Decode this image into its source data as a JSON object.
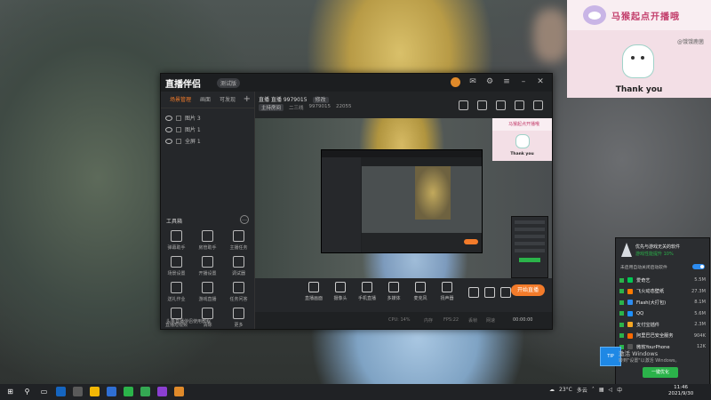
{
  "desktop": {},
  "overlay": {
    "title": "马猴起点开播哦",
    "sub": "@饿饿鹿菌",
    "thank": "Thank you"
  },
  "app": {
    "brand": "直播伴侣",
    "version": "测试版",
    "tabs": [
      "场景管理",
      "画面",
      "可发现"
    ],
    "layers": [
      {
        "name": "图片 3"
      },
      {
        "name": "图片 1"
      },
      {
        "name": "全屏 1"
      }
    ],
    "tools_title": "工具箱",
    "tools": [
      {
        "label": "弹幕助手"
      },
      {
        "label": "房管助手"
      },
      {
        "label": "主播任务"
      },
      {
        "label": "场景设置"
      },
      {
        "label": "开播设置"
      },
      {
        "label": "调试器"
      },
      {
        "label": "送礼作业"
      },
      {
        "label": "游戏直播"
      },
      {
        "label": "任务问答"
      },
      {
        "label": "直播短视频"
      },
      {
        "label": "清除"
      },
      {
        "label": "更多"
      }
    ],
    "left_tip": "头条直播伴侣使用教程",
    "room_title": "直播 直播",
    "room_id": "9979015",
    "room_tag": "修改",
    "room_meta_badge": "主持房间",
    "room_meta_1": "二三线",
    "room_meta_2": "9979015",
    "room_meta_3": "22055",
    "bottom_items": [
      {
        "label": "直播画面"
      },
      {
        "label": "摄像头"
      },
      {
        "label": "手机直播"
      },
      {
        "label": "多媒体"
      },
      {
        "label": "麦克风"
      },
      {
        "label": "扬声器"
      }
    ],
    "start_button": "开始直播",
    "status": {
      "cpu": "CPU: 14%",
      "mem": "内存",
      "fps": "FPS:22",
      "drop": "丢帧",
      "net": "网速",
      "time": "00:00:00"
    },
    "nested_mini": {
      "title": "马猴起点开播哦",
      "thank": "Thank you"
    }
  },
  "popup": {
    "title": "优先与游戏无关的软件",
    "sub": "游戏性能提升 10%",
    "option": "未启用自动关闭启动软件",
    "items": [
      {
        "name": "爱奇艺",
        "size": "5.5M",
        "color": "#00c853"
      },
      {
        "name": "飞火动态壁纸",
        "size": "27.3M",
        "color": "#ff7a00"
      },
      {
        "name": "Flash(大打包)",
        "size": "8.1M",
        "color": "#2d8cf0"
      },
      {
        "name": "QQ",
        "size": "5.6M",
        "color": "#1e90ff"
      },
      {
        "name": "支付宝插件",
        "size": "2.3M",
        "color": "#f5a623"
      },
      {
        "name": "阿里巴巴安全服务",
        "size": "904K",
        "color": "#ff6a00"
      },
      {
        "name": "微软YourPhone",
        "size": "12K",
        "color": "#555"
      }
    ],
    "button": "一键优化"
  },
  "activation": {
    "line1": "激活 Windows",
    "line2": "转到\"设置\"以激活 Windows。",
    "tile": "TIP"
  },
  "taskbar": {
    "weather": "23°C",
    "weather_desc": "多云",
    "ime": "中",
    "time": "11:46",
    "date": "2021/9/30"
  }
}
